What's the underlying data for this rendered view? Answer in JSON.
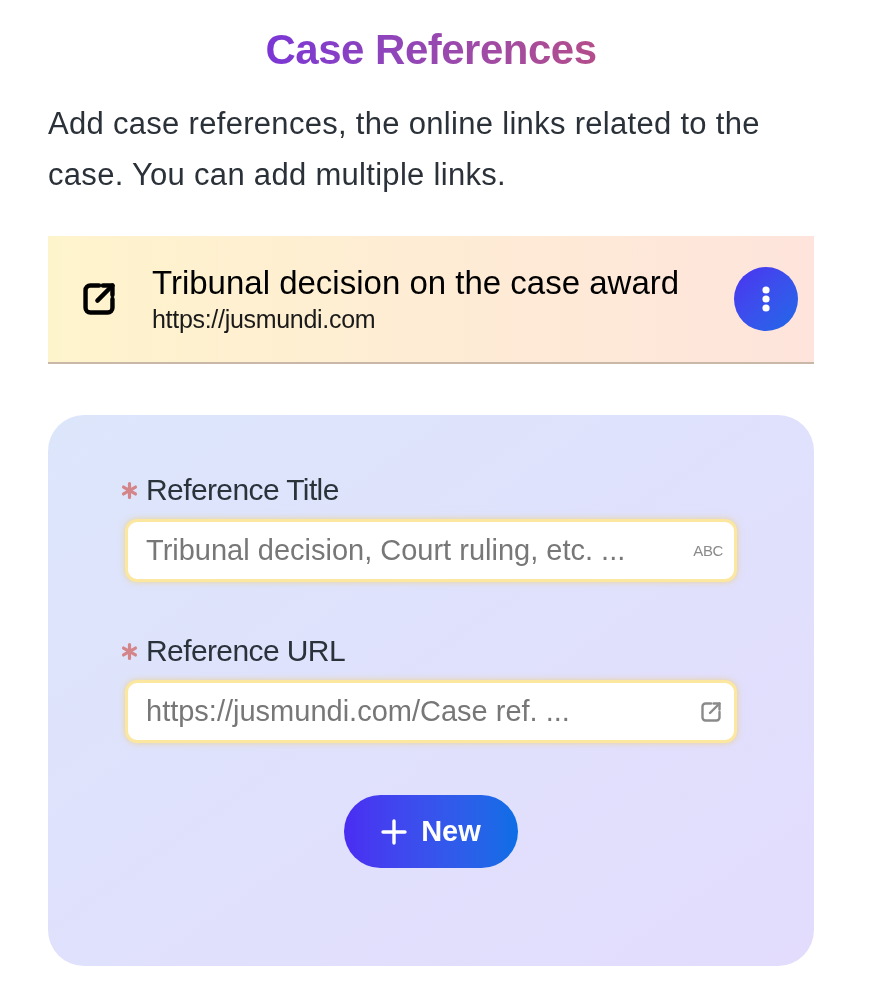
{
  "header": {
    "title": "Case References",
    "description": "Add case references, the online links related to the case. You can add multiple links."
  },
  "references": [
    {
      "title": "Tribunal decision on the case award",
      "url": "https://jusmundi.com"
    }
  ],
  "form": {
    "fields": [
      {
        "kind": "text",
        "label": "Reference Title",
        "required": true,
        "placeholder": "Tribunal decision, Court ruling, etc. ...",
        "suffix": "ABC"
      },
      {
        "kind": "url",
        "label": "Reference URL",
        "required": true,
        "placeholder": "https://jusmundi.com/Case ref. ..."
      }
    ],
    "button": {
      "label": "New"
    }
  }
}
